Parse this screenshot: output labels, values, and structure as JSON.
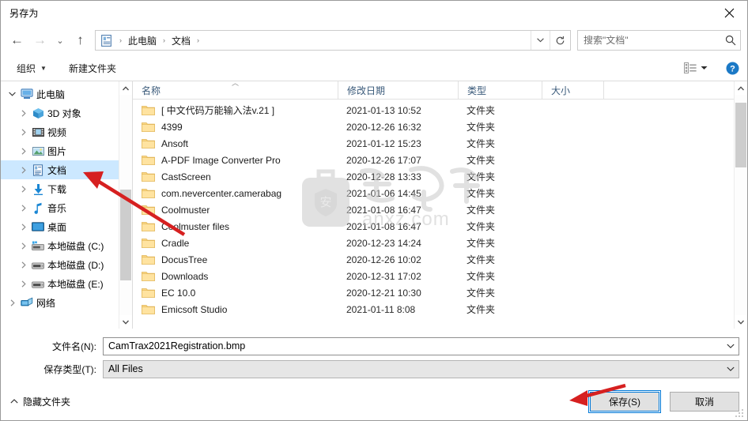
{
  "window": {
    "title": "另存为",
    "close_label": "✕"
  },
  "nav": {
    "back_label": "←",
    "forward_label": "→",
    "recent_label": "⌄",
    "up_label": "↑",
    "breadcrumb_icon": "documents-icon",
    "crumbs": [
      "此电脑",
      "文档"
    ],
    "separator": "›",
    "address_dropdown": "⌄",
    "refresh_label": "↻"
  },
  "search": {
    "placeholder": "搜索\"文档\"",
    "value": "",
    "icon": "search-icon"
  },
  "commandbar": {
    "organize_label": "组织",
    "organize_caret": "▼",
    "new_folder_label": "新建文件夹",
    "view_icon": "view-layout-icon",
    "view_caret": "▼",
    "help_icon": "help-icon",
    "help_glyph": "?"
  },
  "sidebar": {
    "items": [
      {
        "label": "此电脑",
        "icon": "this-pc-icon",
        "indent": 0,
        "expanded": true,
        "selected": false,
        "twisty": "⌄"
      },
      {
        "label": "3D 对象",
        "icon": "3d-objects-icon",
        "indent": 1,
        "expanded": false,
        "selected": false,
        "twisty": "›"
      },
      {
        "label": "视频",
        "icon": "videos-icon",
        "indent": 1,
        "expanded": false,
        "selected": false,
        "twisty": "›"
      },
      {
        "label": "图片",
        "icon": "pictures-icon",
        "indent": 1,
        "expanded": false,
        "selected": false,
        "twisty": "›"
      },
      {
        "label": "文档",
        "icon": "documents-icon",
        "indent": 1,
        "expanded": false,
        "selected": true,
        "twisty": "›"
      },
      {
        "label": "下载",
        "icon": "downloads-icon",
        "indent": 1,
        "expanded": false,
        "selected": false,
        "twisty": "›"
      },
      {
        "label": "音乐",
        "icon": "music-icon",
        "indent": 1,
        "expanded": false,
        "selected": false,
        "twisty": "›"
      },
      {
        "label": "桌面",
        "icon": "desktop-icon",
        "indent": 1,
        "expanded": false,
        "selected": false,
        "twisty": "›"
      },
      {
        "label": "本地磁盘 (C:)",
        "icon": "system-drive-icon",
        "indent": 1,
        "expanded": false,
        "selected": false,
        "twisty": "›"
      },
      {
        "label": "本地磁盘 (D:)",
        "icon": "drive-icon",
        "indent": 1,
        "expanded": false,
        "selected": false,
        "twisty": "›"
      },
      {
        "label": "本地磁盘 (E:)",
        "icon": "drive-icon",
        "indent": 1,
        "expanded": false,
        "selected": false,
        "twisty": "›"
      },
      {
        "label": "网络",
        "icon": "network-icon",
        "indent": 0,
        "expanded": false,
        "selected": false,
        "twisty": "›"
      }
    ],
    "scroll_up": "︿",
    "scroll_down": "﹀"
  },
  "filelist": {
    "columns": [
      {
        "label": "名称",
        "key": "name",
        "sorted": true
      },
      {
        "label": "修改日期",
        "key": "date",
        "sorted": false
      },
      {
        "label": "类型",
        "key": "type",
        "sorted": false
      },
      {
        "label": "大小",
        "key": "size",
        "sorted": false
      }
    ],
    "sort_indicator": "︿",
    "rows": [
      {
        "name": "[ 中文代码万能输入法v.21 ]",
        "date": "2021-01-13 10:52",
        "type": "文件夹",
        "size": ""
      },
      {
        "name": "4399",
        "date": "2020-12-26 16:32",
        "type": "文件夹",
        "size": ""
      },
      {
        "name": "Ansoft",
        "date": "2021-01-12 15:23",
        "type": "文件夹",
        "size": ""
      },
      {
        "name": "A-PDF Image Converter Pro",
        "date": "2020-12-26 17:07",
        "type": "文件夹",
        "size": ""
      },
      {
        "name": "CastScreen",
        "date": "2020-12-28 13:33",
        "type": "文件夹",
        "size": ""
      },
      {
        "name": "com.nevercenter.camerabag",
        "date": "2021-01-06 14:45",
        "type": "文件夹",
        "size": ""
      },
      {
        "name": "Coolmuster",
        "date": "2021-01-08 16:47",
        "type": "文件夹",
        "size": ""
      },
      {
        "name": "Coolmuster files",
        "date": "2021-01-08 16:47",
        "type": "文件夹",
        "size": ""
      },
      {
        "name": "Cradle",
        "date": "2020-12-23 14:24",
        "type": "文件夹",
        "size": ""
      },
      {
        "name": "DocusTree",
        "date": "2020-12-26 10:02",
        "type": "文件夹",
        "size": ""
      },
      {
        "name": "Downloads",
        "date": "2020-12-31 17:02",
        "type": "文件夹",
        "size": ""
      },
      {
        "name": "EC 10.0",
        "date": "2020-12-21 10:30",
        "type": "文件夹",
        "size": ""
      },
      {
        "name": "Emicsoft Studio",
        "date": "2021-01-11 8:08",
        "type": "文件夹",
        "size": ""
      }
    ],
    "scroll_up": "︿",
    "scroll_down": "﹀"
  },
  "watermark": {
    "text": "anxz.com",
    "logo_glyph": "安"
  },
  "form": {
    "filename_label": "文件名(N):",
    "filename_value": "CamTrax2021Registration.bmp",
    "filetype_label": "保存类型(T):",
    "filetype_value": "All Files",
    "dropdown_glyph": "⌄"
  },
  "footer": {
    "hide_folders_label": "隐藏文件夹",
    "hide_folders_caret": "︿",
    "save_label": "保存(S)",
    "cancel_label": "取消"
  },
  "colors": {
    "accent": "#0078d7",
    "selection": "#cce8ff",
    "folder": "#ffd076",
    "header_text": "#3a5a7a"
  }
}
